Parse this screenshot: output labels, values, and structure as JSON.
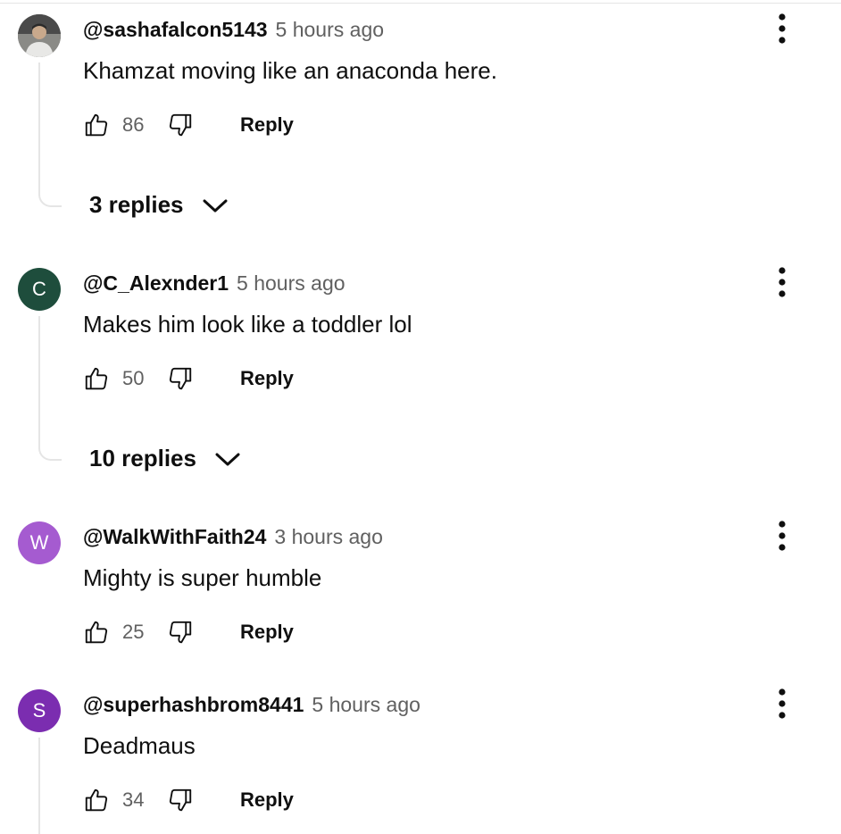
{
  "comments": [
    {
      "author": "@sashafalcon5143",
      "time": "5 hours ago",
      "text": "Khamzat moving like an anaconda here.",
      "likes": "86",
      "reply_label": "Reply",
      "avatar": {
        "type": "photo",
        "color": "#6b6b6b"
      },
      "replies_label": "3 replies"
    },
    {
      "author": "@C_Alexnder1",
      "time": "5 hours ago",
      "text": "Makes him look like a toddler lol",
      "likes": "50",
      "reply_label": "Reply",
      "avatar": {
        "type": "letter",
        "letter": "C",
        "color": "#1e4d3c"
      },
      "replies_label": "10 replies"
    },
    {
      "author": "@WalkWithFaith24",
      "time": "3 hours ago",
      "text": "Mighty is super humble",
      "likes": "25",
      "reply_label": "Reply",
      "avatar": {
        "type": "letter",
        "letter": "W",
        "color": "#a55bd0"
      }
    },
    {
      "author": "@superhashbrom8441",
      "time": "5 hours ago",
      "text": "Deadmaus",
      "likes": "34",
      "reply_label": "Reply",
      "avatar": {
        "type": "letter",
        "letter": "S",
        "color": "#7b2db0"
      }
    }
  ],
  "icons": {
    "like": "thumbs-up-icon",
    "dislike": "thumbs-down-icon",
    "more": "more-vertical-icon",
    "expand": "chevron-down-icon"
  }
}
